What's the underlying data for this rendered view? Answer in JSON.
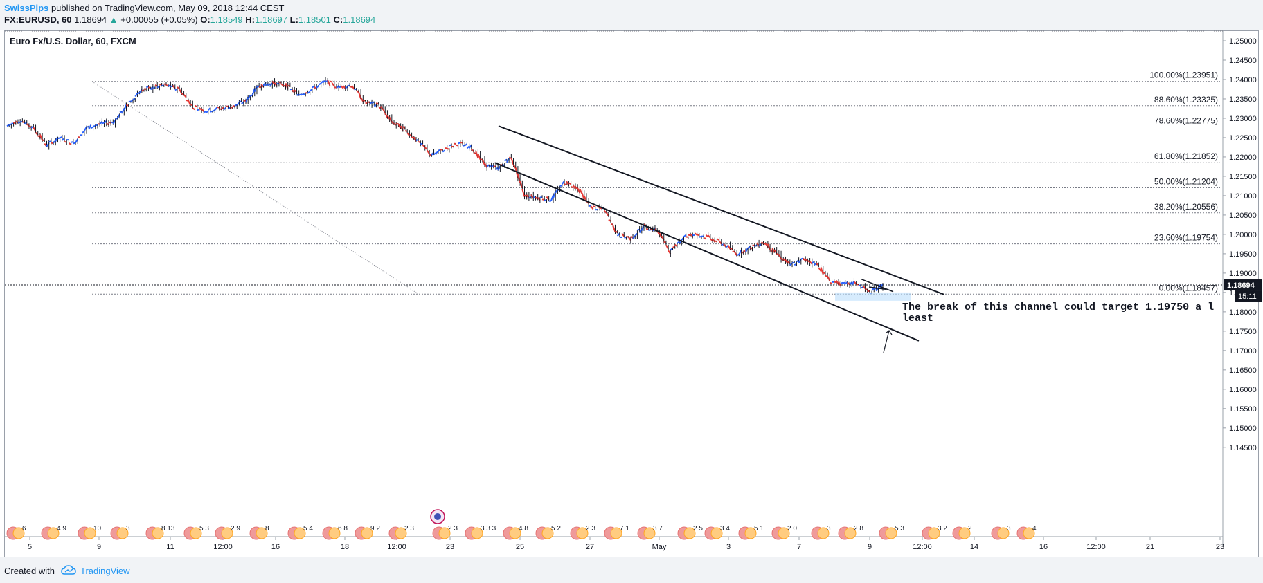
{
  "header": {
    "author": "SwissPips",
    "published": "published on TradingView.com, May 09, 2018 12:44 CEST",
    "symbol_line": "FX:EURUSD, 60",
    "last": "1.18694",
    "arrow": "▲",
    "change": "+0.00055 (+0.05%)",
    "o_label": "O:",
    "o": "1.18549",
    "h_label": "H:",
    "h": "1.18697",
    "l_label": "L:",
    "l": "1.18501",
    "c_label": "C:",
    "c": "1.18694"
  },
  "chart_title": "Euro Fx/U.S. Dollar, 60, FXCM",
  "footer": {
    "created": "Created with",
    "brand": "TradingView"
  },
  "colors": {
    "up": "#2962ff",
    "down": "#e53935",
    "wick": "#131722",
    "accent": "#2196f3",
    "green": "#26a69a"
  },
  "chart_data": {
    "type": "line",
    "title": "Euro Fx/U.S. Dollar, 60, FXCM",
    "ylim": [
      1.1405,
      1.2525
    ],
    "y_ticks": [
      "1.14500",
      "1.15000",
      "1.15500",
      "1.16000",
      "1.16500",
      "1.17000",
      "1.17500",
      "1.18000",
      "1.18500",
      "1.19000",
      "1.19500",
      "1.20000",
      "1.20500",
      "1.21000",
      "1.21500",
      "1.22000",
      "1.22500",
      "1.23000",
      "1.23500",
      "1.24000",
      "1.24500",
      "1.25000"
    ],
    "x_ticks": [
      "5",
      "9",
      "11",
      "12:00",
      "16",
      "18",
      "12:00",
      "23",
      "25",
      "27",
      "May",
      "3",
      "7",
      "9",
      "12:00",
      "14",
      "16",
      "12:00",
      "21",
      "23"
    ],
    "price_path": [
      [
        "Apr 4",
        1.228
      ],
      [
        "Apr 4",
        1.2295
      ],
      [
        "Apr 5",
        1.2275
      ],
      [
        "Apr 6",
        1.223
      ],
      [
        "Apr 6",
        1.225
      ],
      [
        "Apr 7",
        1.2235
      ],
      [
        "Apr 9",
        1.2275
      ],
      [
        "Apr 9",
        1.2285
      ],
      [
        "Apr 10",
        1.229
      ],
      [
        "Apr 10",
        1.233
      ],
      [
        "Apr 10",
        1.237
      ],
      [
        "Apr 11",
        1.238
      ],
      [
        "Apr 11",
        1.2385
      ],
      [
        "Apr 12",
        1.2375
      ],
      [
        "Apr 12",
        1.233
      ],
      [
        "Apr 13",
        1.232
      ],
      [
        "Apr 13",
        1.2325
      ],
      [
        "Apr 14",
        1.233
      ],
      [
        "Apr 15",
        1.2345
      ],
      [
        "Apr 16",
        1.2385
      ],
      [
        "Apr 16",
        1.239
      ],
      [
        "Apr 17",
        1.2385
      ],
      [
        "Apr 17",
        1.236
      ],
      [
        "Apr 18",
        1.2375
      ],
      [
        "Apr 18",
        1.2395
      ],
      [
        "Apr 19",
        1.238
      ],
      [
        "Apr 19",
        1.2385
      ],
      [
        "Apr 20",
        1.234
      ],
      [
        "Apr 20",
        1.2335
      ],
      [
        "Apr 22",
        1.229
      ],
      [
        "Apr 22",
        1.227
      ],
      [
        "Apr 23",
        1.224
      ],
      [
        "Apr 23",
        1.2205
      ],
      [
        "Apr 24",
        1.222
      ],
      [
        "Apr 24",
        1.2235
      ],
      [
        "Apr 25",
        1.2225
      ],
      [
        "Apr 25",
        1.218
      ],
      [
        "Apr 26",
        1.217
      ],
      [
        "Apr 26",
        1.22
      ],
      [
        "Apr 26",
        1.21
      ],
      [
        "Apr 27",
        1.2095
      ],
      [
        "Apr 27",
        1.209
      ],
      [
        "Apr 28",
        1.2135
      ],
      [
        "Apr 28",
        1.212
      ],
      [
        "Apr 29",
        1.207
      ],
      [
        "Apr 30",
        1.2065
      ],
      [
        "Apr 30",
        1.2
      ],
      [
        "May 1",
        1.199
      ],
      [
        "May 1",
        1.202
      ],
      [
        "May 2",
        1.201
      ],
      [
        "May 2",
        1.1955
      ],
      [
        "May 3",
        1.1995
      ],
      [
        "May 3",
        1.2
      ],
      [
        "May 4",
        1.199
      ],
      [
        "May 4",
        1.1975
      ],
      [
        "May 5",
        1.195
      ],
      [
        "May 6",
        1.1965
      ],
      [
        "May 6",
        1.198
      ],
      [
        "May 7",
        1.195
      ],
      [
        "May 7",
        1.192
      ],
      [
        "May 7",
        1.1935
      ],
      [
        "May 8",
        1.1925
      ],
      [
        "May 8",
        1.188
      ],
      [
        "May 8",
        1.187
      ],
      [
        "May 9",
        1.1875
      ],
      [
        "May 9",
        1.185
      ],
      [
        "May 9",
        1.1869
      ]
    ],
    "fib_levels": [
      {
        "label": "100.00%(1.23951)",
        "value": 1.23951
      },
      {
        "label": "88.60%(1.23325)",
        "value": 1.23325
      },
      {
        "label": "78.60%(1.22775)",
        "value": 1.22775
      },
      {
        "label": "61.80%(1.21852)",
        "value": 1.21852
      },
      {
        "label": "50.00%(1.21204)",
        "value": 1.21204
      },
      {
        "label": "38.20%(1.20556)",
        "value": 1.20556
      },
      {
        "label": "23.60%(1.19754)",
        "value": 1.19754
      },
      {
        "label": "0.00%(1.18457)",
        "value": 1.18457
      }
    ],
    "channel": {
      "upper": [
        [
          "Apr 24",
          1.228
        ],
        [
          "May 12",
          1.1845
        ]
      ],
      "lower": [
        [
          "Apr 24",
          1.2185
        ],
        [
          "May 11",
          1.1725
        ]
      ]
    },
    "fib_anchor_line": [
      [
        "Apr 9",
        1.2395
      ],
      [
        "Apr 21",
        1.1845
      ]
    ],
    "annotation": "The break of this channel could target 1.19750 a least",
    "last_price_label": "1.18694",
    "countdown_label": "15:11",
    "event_markers": [
      "6",
      "4 9",
      "10",
      "3",
      "8 13",
      "5 3",
      "2 9",
      "8",
      "5 4",
      "6 8",
      "9 2",
      "2 3",
      "2 3",
      "3 3 3",
      "4 8",
      "5 2",
      "2 3",
      "7 1",
      "3 7",
      "2 5",
      "3 4",
      "5 1",
      "2 0",
      "3",
      "2 8",
      "5 3",
      "3 2",
      "2",
      "3",
      "4"
    ]
  }
}
